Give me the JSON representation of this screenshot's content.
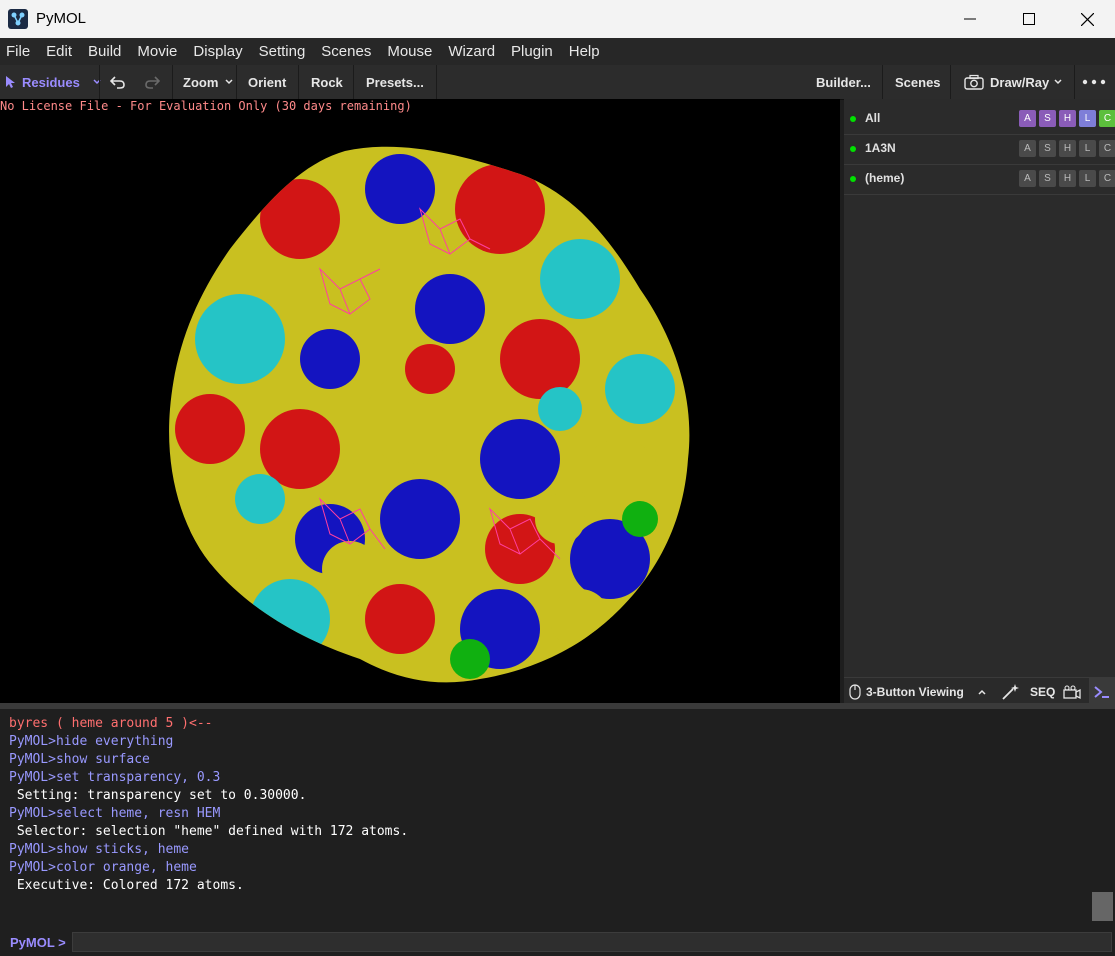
{
  "window": {
    "title": "PyMOL"
  },
  "menubar": {
    "items": [
      "File",
      "Edit",
      "Build",
      "Movie",
      "Display",
      "Setting",
      "Scenes",
      "Mouse",
      "Wizard",
      "Plugin",
      "Help"
    ]
  },
  "toolbar": {
    "selection_mode": "Residues",
    "zoom": "Zoom",
    "orient": "Orient",
    "rock": "Rock",
    "presets": "Presets...",
    "builder": "Builder...",
    "scenes": "Scenes",
    "draw_ray": "Draw/Ray"
  },
  "viewport": {
    "license_notice": "No License File - For Evaluation Only (30 days remaining)"
  },
  "object_panel": {
    "objects": [
      {
        "name": "All",
        "enabled": true,
        "buttons": [
          "A",
          "S",
          "H",
          "L",
          "C"
        ]
      },
      {
        "name": "1A3N",
        "enabled": true,
        "buttons": [
          "A",
          "S",
          "H",
          "L",
          "C"
        ]
      },
      {
        "name": "(heme)",
        "enabled": true,
        "buttons": [
          "A",
          "S",
          "H",
          "L",
          "C"
        ]
      }
    ],
    "button_colors_all": {
      "A": "#8a5cb8",
      "S": "#8a5cb8",
      "H": "#8a5cb8",
      "L": "#7e7ed8",
      "C": "#5cbf3c"
    }
  },
  "bottom_bar": {
    "mouse_mode": "3-Button Viewing",
    "seq": "SEQ"
  },
  "console": {
    "lines": [
      {
        "type": "err",
        "text": "byres ( heme around 5 )<--"
      },
      {
        "type": "cmd",
        "text": "PyMOL>hide everything"
      },
      {
        "type": "cmd",
        "text": "PyMOL>show surface"
      },
      {
        "type": "cmd",
        "text": "PyMOL>set transparency, 0.3"
      },
      {
        "type": "out",
        "text": " Setting: transparency set to 0.30000."
      },
      {
        "type": "cmd",
        "text": "PyMOL>select heme, resn HEM"
      },
      {
        "type": "out",
        "text": " Selector: selection \"heme\" defined with 172 atoms."
      },
      {
        "type": "cmd",
        "text": "PyMOL>show sticks, heme"
      },
      {
        "type": "cmd",
        "text": "PyMOL>color orange, heme"
      },
      {
        "type": "out",
        "text": " Executive: Colored 172 atoms."
      }
    ],
    "prompt_label": "PyMOL >",
    "input_value": ""
  }
}
